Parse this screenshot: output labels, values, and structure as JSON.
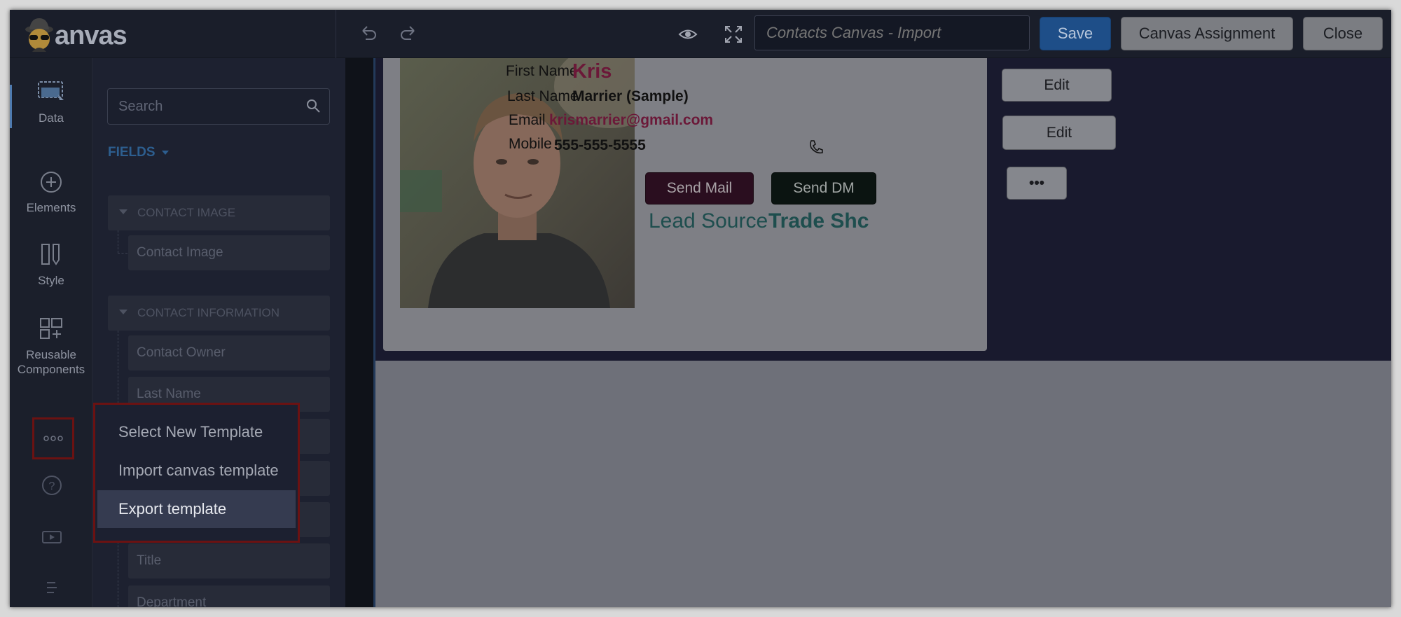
{
  "topbar": {
    "logo_text": "anvas",
    "canvas_name_placeholder": "Contacts Canvas - Import",
    "save_label": "Save",
    "assign_label": "Canvas Assignment",
    "close_label": "Close"
  },
  "rail": {
    "items": [
      {
        "label": "Data",
        "icon": "data-icon"
      },
      {
        "label": "Elements",
        "icon": "plus-circle-icon"
      },
      {
        "label": "Style",
        "icon": "style-icon"
      },
      {
        "label": "Reusable Components",
        "icon": "components-icon"
      }
    ],
    "more_icon": "more-icon",
    "help_icon": "help-icon",
    "video_icon": "video-icon",
    "list_icon": "list-icon"
  },
  "panel": {
    "search_placeholder": "Search",
    "fields_header": "FIELDS",
    "groups": [
      {
        "label": "CONTACT IMAGE",
        "fields": [
          "Contact Image"
        ]
      },
      {
        "label": "CONTACT INFORMATION",
        "fields": [
          "Contact Owner",
          "Last Name",
          "",
          "",
          "",
          "Title",
          "Department"
        ]
      }
    ]
  },
  "card": {
    "first_name_label": "First Name",
    "first_name_value": "Kris",
    "last_name_label": "Last Name",
    "last_name_value": "Marrier (Sample)",
    "email_label": "Email",
    "email_value": "krismarrier@gmail.com",
    "mobile_label": "Mobile",
    "mobile_value": "555-555-5555",
    "send_mail_label": "Send Mail",
    "send_dm_label": "Send DM",
    "lead_source_label": "Lead Source",
    "lead_source_value": "Trade Shc"
  },
  "side_buttons": {
    "edit1": "Edit",
    "edit2": "Edit",
    "more": "•••"
  },
  "menu": {
    "items": [
      "Select New Template",
      "Import canvas template",
      "Export template"
    ],
    "active_index": 2
  },
  "colors": {
    "accent": "#1e4e88",
    "menu_border": "#6b1212",
    "first_name": "#6b1838",
    "email": "#6b1838",
    "lead_source": "#1e4e4e"
  }
}
